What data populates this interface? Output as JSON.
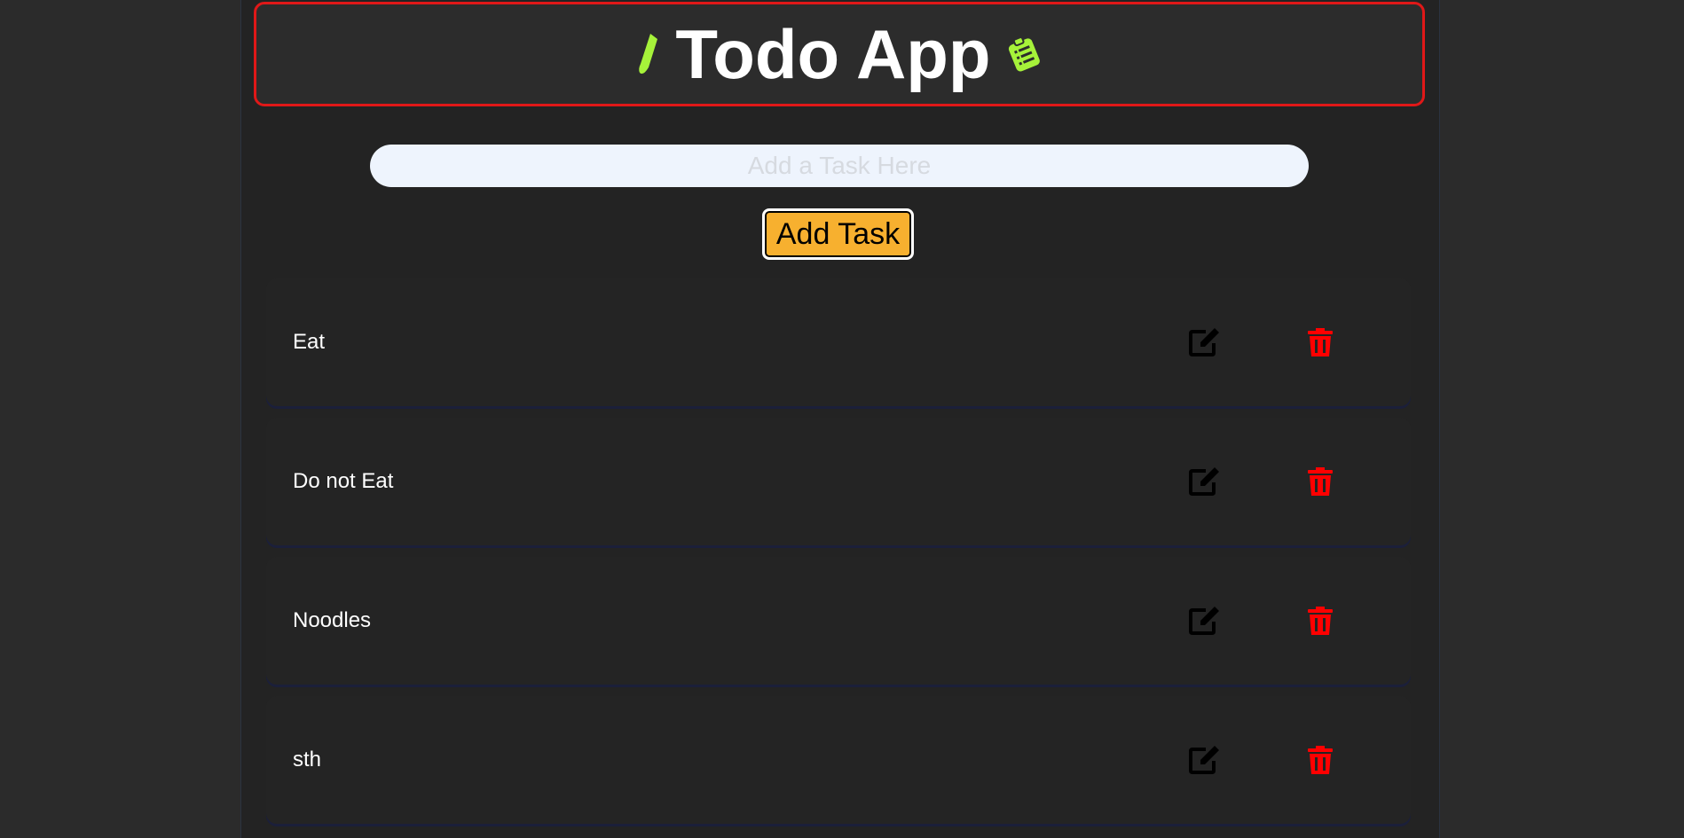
{
  "header": {
    "title": "Todo App",
    "left_icon": "pencil-icon",
    "right_icon": "clipboard-list-icon",
    "icon_color": "#a6f23a",
    "border_color": "#e01818"
  },
  "input": {
    "placeholder": "Add a Task Here",
    "value": ""
  },
  "add_button": {
    "label": "Add Task",
    "color": "#f7b02f"
  },
  "tasks": [
    {
      "text": "Eat",
      "edit_icon": "edit-icon",
      "delete_icon": "trash-icon"
    },
    {
      "text": "Do not Eat",
      "edit_icon": "edit-icon",
      "delete_icon": "trash-icon"
    },
    {
      "text": "Noodles",
      "edit_icon": "edit-icon",
      "delete_icon": "trash-icon"
    },
    {
      "text": "sth",
      "edit_icon": "edit-icon",
      "delete_icon": "trash-icon"
    }
  ],
  "colors": {
    "delete": "#ff0000",
    "edit": "#000000"
  }
}
